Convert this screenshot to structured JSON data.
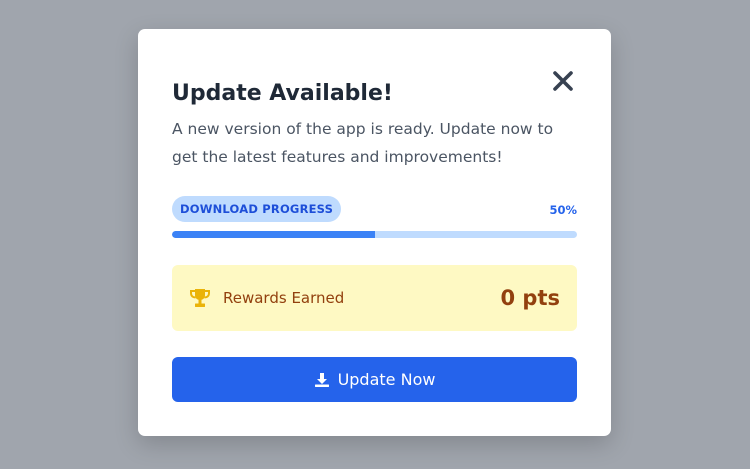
{
  "modal": {
    "title": "Update Available!",
    "description": "A new version of the app is ready. Update now to get the latest features and improvements!",
    "close_icon": "close-icon"
  },
  "progress": {
    "label": "DOWNLOAD PROGRESS",
    "percent_text": "50%",
    "value": 0.5,
    "colors": {
      "fill": "#3b82f6",
      "track": "#bfdbfe"
    }
  },
  "rewards": {
    "icon": "trophy-icon",
    "label": "Rewards Earned",
    "value": "0 pts",
    "colors": {
      "background": "#fef9c3",
      "text": "#92400e",
      "icon": "#eab308"
    }
  },
  "update_button": {
    "icon": "download-icon",
    "label": "Update Now",
    "color": "#2563eb"
  }
}
